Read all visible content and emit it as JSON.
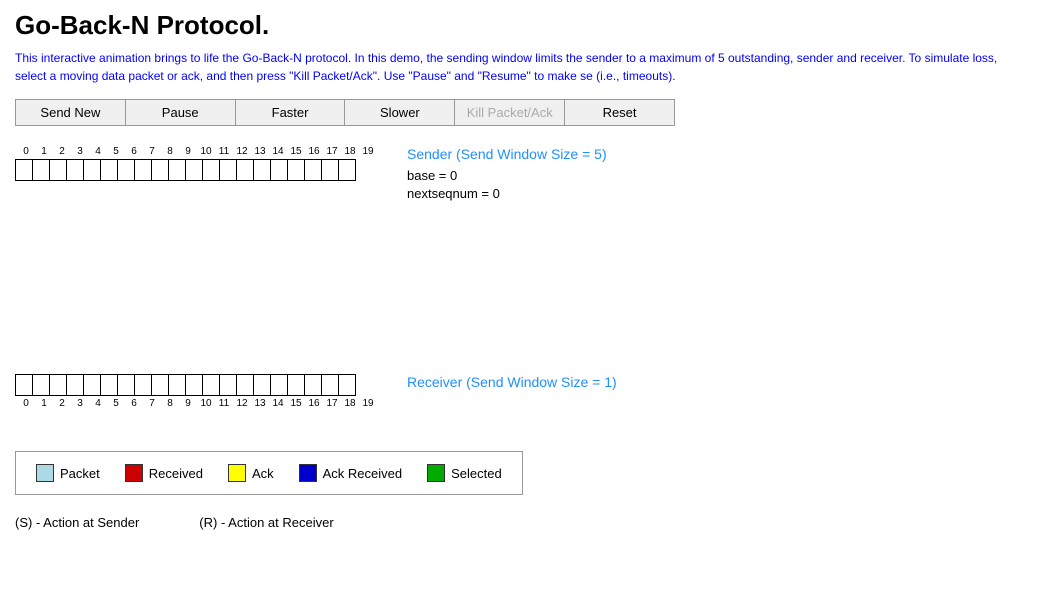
{
  "title": "Go-Back-N Protocol.",
  "description": "This interactive animation brings to life the Go-Back-N protocol. In this demo, the sending window limits the sender to a maximum of 5 outstanding, sender and receiver. To simulate loss, select a moving data packet or ack, and then press \"Kill Packet/Ack\". Use \"Pause\" and \"Resume\" to make se (i.e., timeouts).",
  "toolbar": {
    "send_new": "Send New",
    "pause": "Pause",
    "faster": "Faster",
    "slower": "Slower",
    "kill_packet": "Kill Packet/Ack",
    "reset": "Reset"
  },
  "sender": {
    "title": "Sender (Send Window Size = 5)",
    "base_label": "base = 0",
    "nextseqnum_label": "nextseqnum = 0",
    "seq_numbers": [
      0,
      1,
      2,
      3,
      4,
      5,
      6,
      7,
      8,
      9,
      10,
      11,
      12,
      13,
      14,
      15,
      16,
      17,
      18,
      19
    ],
    "num_boxes": 20
  },
  "receiver": {
    "title": "Receiver (Send Window Size = 1)",
    "seq_numbers": [
      0,
      1,
      2,
      3,
      4,
      5,
      6,
      7,
      8,
      9,
      10,
      11,
      12,
      13,
      14,
      15,
      16,
      17,
      18,
      19
    ],
    "num_boxes": 20
  },
  "legend": {
    "items": [
      {
        "label": "Packet",
        "color": "#add8e6"
      },
      {
        "label": "Received",
        "color": "#cc0000"
      },
      {
        "label": "Ack",
        "color": "#ffff00"
      },
      {
        "label": "Ack Received",
        "color": "#0000cc"
      },
      {
        "label": "Selected",
        "color": "#00aa00"
      }
    ]
  },
  "footer": {
    "sender_action": "(S) - Action at Sender",
    "receiver_action": "(R) - Action at Receiver"
  }
}
